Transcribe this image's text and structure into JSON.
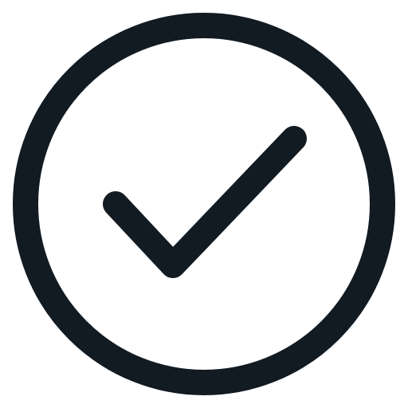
{
  "icon": {
    "name": "check-circle-icon",
    "stroke_color": "#121a22",
    "background_color": "#ffffff"
  }
}
